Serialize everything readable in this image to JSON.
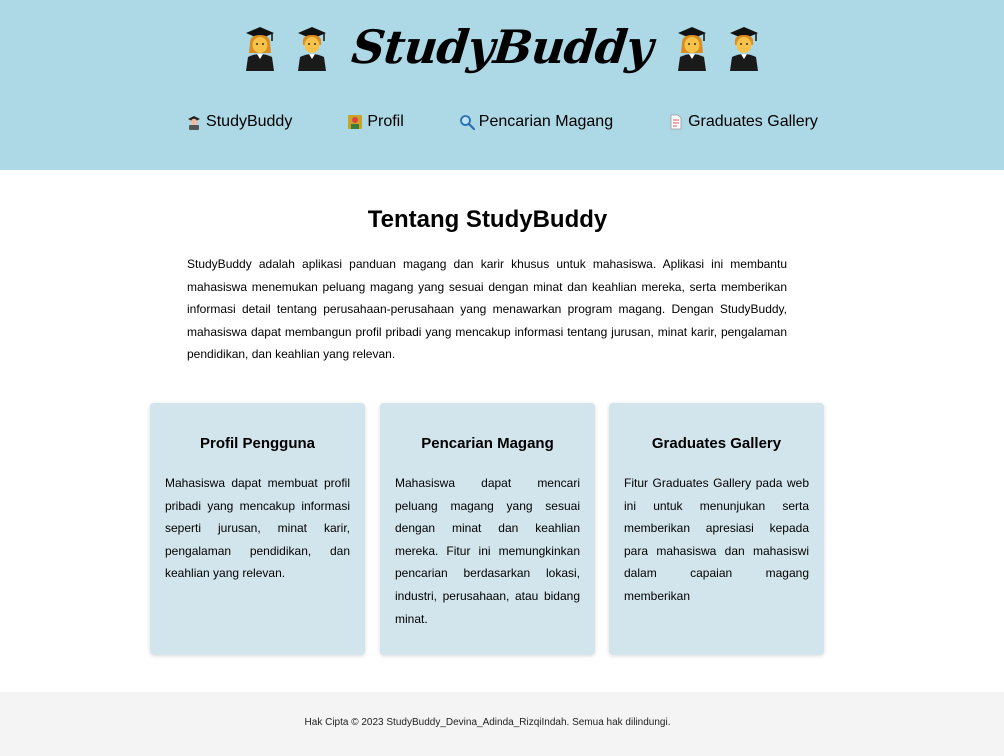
{
  "header": {
    "logo_text": "StudyBuddy",
    "logo_icons": [
      "graduate-icon",
      "graduate-icon",
      "graduate-icon",
      "graduate-icon"
    ],
    "background_color": "#add8e6"
  },
  "nav": {
    "items": [
      {
        "label": "StudyBuddy",
        "icon": "graduate-icon"
      },
      {
        "label": "Profil",
        "icon": "profile-card-icon"
      },
      {
        "label": "Pencarian Magang",
        "icon": "magnifier-icon"
      },
      {
        "label": "Graduates Gallery",
        "icon": "document-icon"
      }
    ]
  },
  "main": {
    "title": "Tentang StudyBuddy",
    "intro": "StudyBuddy adalah aplikasi panduan magang dan karir khusus untuk mahasiswa. Aplikasi ini membantu mahasiswa menemukan peluang magang yang sesuai dengan minat dan keahlian mereka, serta memberikan informasi detail tentang perusahaan-perusahaan yang menawarkan program magang. Dengan StudyBuddy, mahasiswa dapat membangun profil pribadi yang mencakup informasi tentang jurusan, minat karir, pengalaman pendidikan, dan keahlian yang relevan.",
    "cards": [
      {
        "title": "Profil Pengguna",
        "text": "Mahasiswa dapat membuat profil pribadi yang mencakup informasi seperti jurusan, minat karir, pengalaman pendidikan, dan keahlian yang relevan."
      },
      {
        "title": "Pencarian Magang",
        "text": "Mahasiswa dapat mencari peluang magang yang sesuai dengan minat dan keahlian mereka. Fitur ini memungkinkan pencarian berdasarkan lokasi, industri, perusahaan, atau bidang minat."
      },
      {
        "title": "Graduates Gallery",
        "text": "Fitur Graduates Gallery pada web ini untuk menunjukan serta memberikan apresiasi kepada para mahasiswa dan mahasiswi dalam capaian magang memberikan"
      }
    ],
    "card_color": "#d2e5ec"
  },
  "footer": {
    "text": "Hak Cipta © 2023 StudyBuddy_Devina_Adinda_RizqiIndah. Semua hak dilindungi."
  }
}
